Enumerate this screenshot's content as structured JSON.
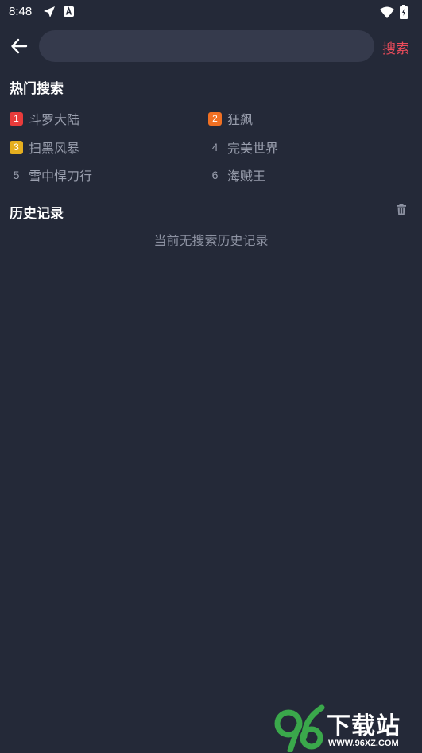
{
  "status_bar": {
    "time": "8:48",
    "icons": [
      "location-arrow-icon",
      "a-notification-icon",
      "wifi-icon",
      "battery-icon"
    ]
  },
  "top_bar": {
    "back_icon": "arrow-left-icon",
    "search_value": "",
    "search_button": "搜索"
  },
  "hot_search": {
    "title": "热门搜索",
    "items": [
      {
        "rank": "1",
        "label": "斗罗大陆",
        "badge_color": "#e83b3b"
      },
      {
        "rank": "2",
        "label": "狂飙",
        "badge_color": "#f07023"
      },
      {
        "rank": "3",
        "label": "扫黑风暴",
        "badge_color": "#e5ae1f"
      },
      {
        "rank": "4",
        "label": "完美世界",
        "badge_color": ""
      },
      {
        "rank": "5",
        "label": "雪中悍刀行",
        "badge_color": ""
      },
      {
        "rank": "6",
        "label": "海贼王",
        "badge_color": ""
      }
    ]
  },
  "history": {
    "title": "历史记录",
    "clear_icon": "trash-icon",
    "empty_text": "当前无搜索历史记录"
  },
  "watermark": {
    "brand": "下载站",
    "logo_text": "96",
    "url": "WWW.96XZ.COM"
  }
}
